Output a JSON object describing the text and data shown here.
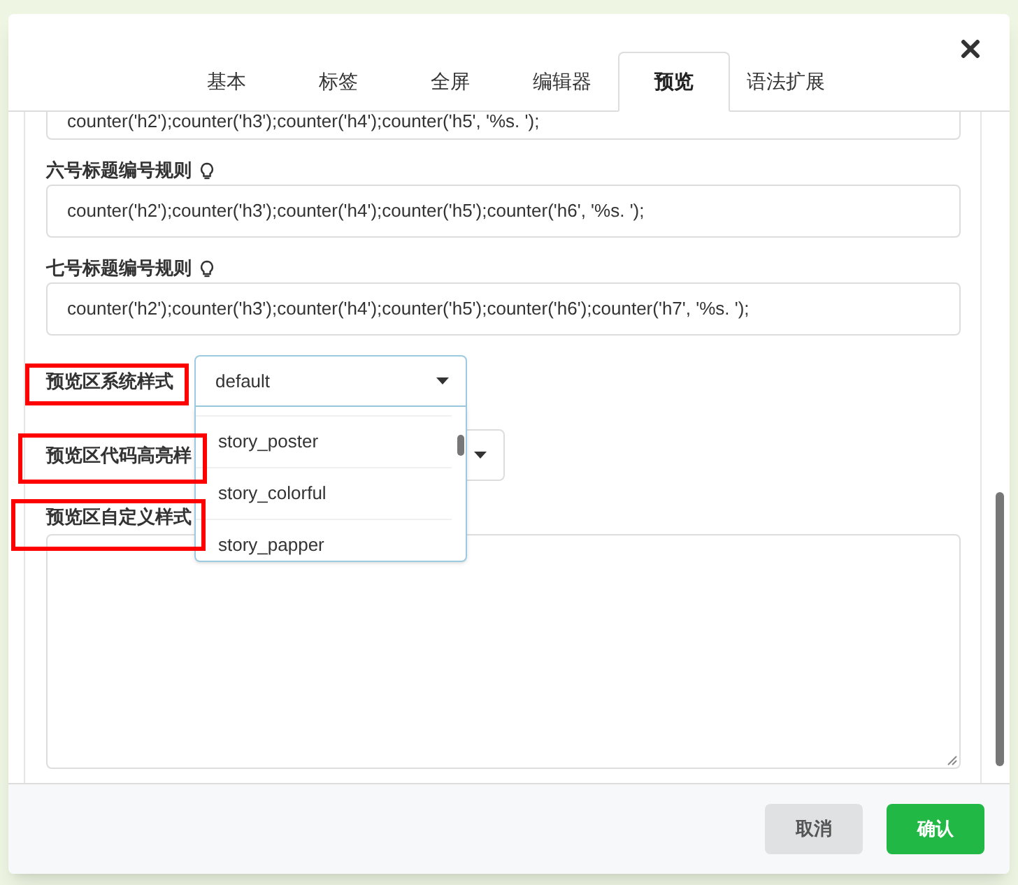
{
  "dialog": {
    "tabs": [
      {
        "label": "基本",
        "selected": false
      },
      {
        "label": "标签",
        "selected": false
      },
      {
        "label": "全屏",
        "selected": false
      },
      {
        "label": "编辑器",
        "selected": false
      },
      {
        "label": "预览",
        "selected": true
      },
      {
        "label": "语法扩展",
        "selected": false
      }
    ],
    "fields": [
      {
        "kind": "text",
        "value": "counter('h2');counter('h3');counter('h4');counter('h5', '%s. ');"
      },
      {
        "kind": "text",
        "label": "六号标题编号规则",
        "hint": true,
        "value": "counter('h2');counter('h3');counter('h4');counter('h5');counter('h6', '%s. ');"
      },
      {
        "kind": "text",
        "label": "七号标题编号规则",
        "hint": true,
        "value": "counter('h2');counter('h3');counter('h4');counter('h5');counter('h6');counter('h7', '%s. ');"
      },
      {
        "kind": "select",
        "label": "预览区系统样式",
        "value": "default",
        "open": true,
        "options": [
          "story_poster",
          "story_colorful",
          "story_papper"
        ],
        "highlighted": true
      },
      {
        "kind": "select",
        "label": "预览区代码高亮样",
        "open": false,
        "highlighted": true
      },
      {
        "kind": "textarea",
        "label": "预览区自定义样式",
        "highlighted": true
      }
    ],
    "buttons": [
      {
        "label": "取消",
        "kind": "secondary"
      },
      {
        "label": "确认",
        "kind": "primary"
      }
    ]
  }
}
